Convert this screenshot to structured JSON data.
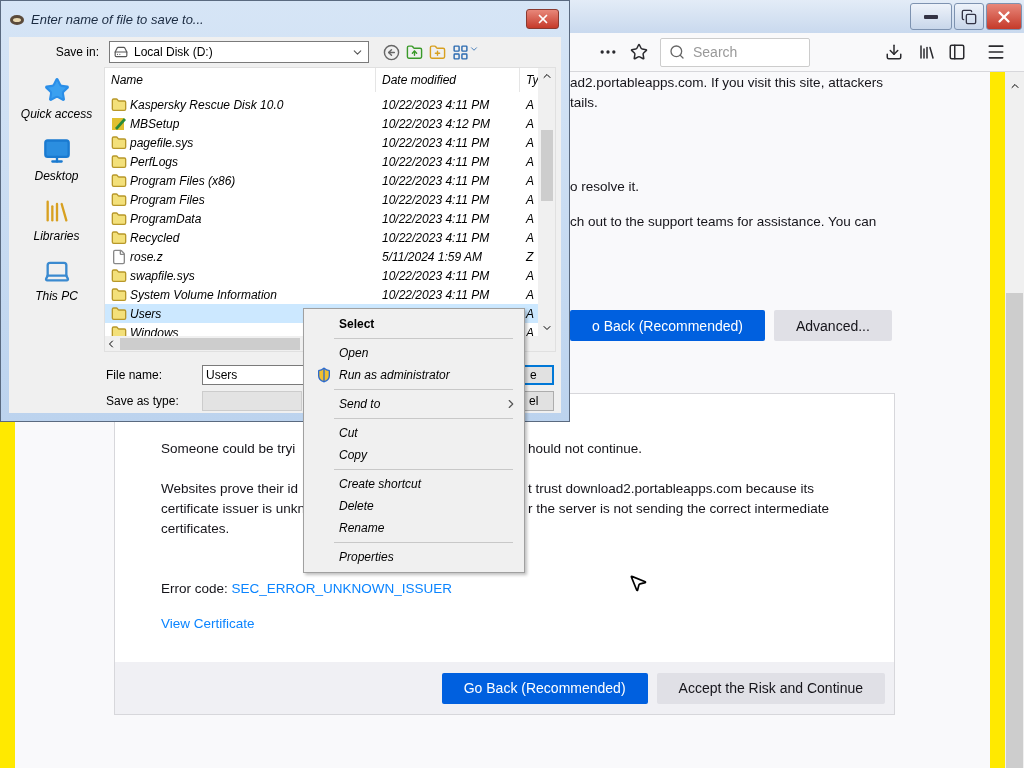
{
  "browser": {
    "search": {
      "placeholder": "Search"
    },
    "upper_paragraphs": [
      [
        "ad2.portableapps.com. If you visit this site, attackers",
        "tails."
      ],
      [
        "o resolve it."
      ],
      [
        "ch out to the support teams for assistance. You can"
      ]
    ],
    "upper_buttons": [
      {
        "label": "o Back (Recommended)",
        "kind": "primary"
      },
      {
        "label": "Advanced...",
        "kind": "secondary"
      }
    ],
    "details": {
      "paragraphs": [
        [
          {
            "left": "Someone could be tryi",
            "right": "hould not continue."
          }
        ],
        [
          {
            "left": "Websites prove their id",
            "right": "t trust download2.portableapps.com because its"
          },
          {
            "left": "certificate issuer is unkn",
            "right": "r the server is not sending the correct intermediate"
          },
          {
            "left": "certificates."
          }
        ]
      ],
      "error_code": {
        "label": "Error code: ",
        "code": "SEC_ERROR_UNKNOWN_ISSUER"
      },
      "view_certificate": "View Certificate",
      "buttons": [
        {
          "label": "Go Back (Recommended)",
          "kind": "primary"
        },
        {
          "label": "Accept the Risk and Continue",
          "kind": "secondary"
        }
      ]
    }
  },
  "dialog": {
    "title": "Enter name of file to save to...",
    "save_in": {
      "label": "Save in:",
      "value": "Local Disk (D:)"
    },
    "places": [
      {
        "label": "Quick access",
        "kind": "star"
      },
      {
        "label": "Desktop",
        "kind": "desktop"
      },
      {
        "label": "Libraries",
        "kind": "library"
      },
      {
        "label": "This PC",
        "kind": "computer"
      }
    ],
    "columns": [
      "Name",
      "Date modified",
      "Ty"
    ],
    "files": [
      {
        "name": "Kaspersky Rescue Disk 10.0",
        "date": "10/22/2023 4:11 PM",
        "type": "A",
        "kind": "folder",
        "selected": false
      },
      {
        "name": "MBSetup",
        "date": "10/22/2023 4:12 PM",
        "type": "A",
        "kind": "setup",
        "selected": false
      },
      {
        "name": "pagefile.sys",
        "date": "10/22/2023 4:11 PM",
        "type": "A",
        "kind": "folder",
        "selected": false
      },
      {
        "name": "PerfLogs",
        "date": "10/22/2023 4:11 PM",
        "type": "A",
        "kind": "folder",
        "selected": false
      },
      {
        "name": "Program Files (x86)",
        "date": "10/22/2023 4:11 PM",
        "type": "A",
        "kind": "folder",
        "selected": false
      },
      {
        "name": "Program Files",
        "date": "10/22/2023 4:11 PM",
        "type": "A",
        "kind": "folder",
        "selected": false
      },
      {
        "name": "ProgramData",
        "date": "10/22/2023 4:11 PM",
        "type": "A",
        "kind": "folder",
        "selected": false
      },
      {
        "name": "Recycled",
        "date": "10/22/2023 4:11 PM",
        "type": "A",
        "kind": "folder",
        "selected": false
      },
      {
        "name": "rose.z",
        "date": "5/11/2024 1:59 AM",
        "type": "Z",
        "kind": "file",
        "selected": false
      },
      {
        "name": "swapfile.sys",
        "date": "10/22/2023 4:11 PM",
        "type": "A",
        "kind": "folder",
        "selected": false
      },
      {
        "name": "System Volume Information",
        "date": "10/22/2023 4:11 PM",
        "type": "A",
        "kind": "folder",
        "selected": false
      },
      {
        "name": "Users",
        "type": "A",
        "kind": "folder",
        "selected": true
      },
      {
        "name": "Windows",
        "type": "A",
        "kind": "folder",
        "selected": false
      }
    ],
    "file_name": {
      "label": "File name:",
      "value": "Users"
    },
    "save_as_type": {
      "label": "Save as type:"
    },
    "buttons": [
      {
        "label": "e",
        "kind": "default"
      },
      {
        "label": "el",
        "kind": "normal"
      }
    ]
  },
  "context_menu": {
    "groups": [
      [
        {
          "label": "Select",
          "kind": "default"
        }
      ],
      [
        {
          "label": "Open",
          "kind": "plain"
        },
        {
          "label": "Run as administrator",
          "kind": "admin"
        }
      ],
      [
        {
          "label": "Send to",
          "kind": "submenu"
        }
      ],
      [
        {
          "label": "Cut",
          "kind": "plain"
        },
        {
          "label": "Copy",
          "kind": "plain"
        }
      ],
      [
        {
          "label": "Create shortcut",
          "kind": "plain"
        },
        {
          "label": "Delete",
          "kind": "plain"
        },
        {
          "label": "Rename",
          "kind": "plain"
        }
      ],
      [
        {
          "label": "Properties",
          "kind": "plain"
        }
      ]
    ]
  }
}
